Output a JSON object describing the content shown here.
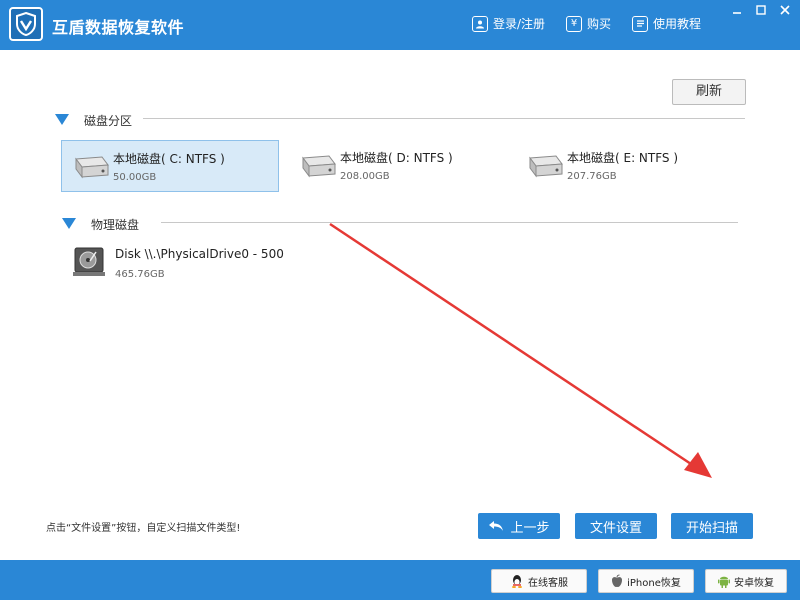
{
  "app": {
    "title": "互盾数据恢复软件"
  },
  "toolbar": {
    "login": "登录/注册",
    "buy": "购买",
    "tutorial": "使用教程",
    "buy_glyph": "¥"
  },
  "refresh_label": "刷新",
  "sections": {
    "partitions": "磁盘分区",
    "physical": "物理磁盘"
  },
  "partitions": [
    {
      "name": "本地磁盘( C: NTFS )",
      "size": "50.00GB",
      "selected": true
    },
    {
      "name": "本地磁盘( D: NTFS )",
      "size": "208.00GB",
      "selected": false
    },
    {
      "name": "本地磁盘( E: NTFS )",
      "size": "207.76GB",
      "selected": false
    }
  ],
  "physical_disks": [
    {
      "name": "Disk \\\\.\\PhysicalDrive0 - 500",
      "size": "465.76GB"
    }
  ],
  "hint": "点击“文件设置”按钮，自定义扫描文件类型!",
  "buttons": {
    "back": "上一步",
    "file_settings": "文件设置",
    "start_scan": "开始扫描"
  },
  "bottom": {
    "service": "在线客服",
    "iphone": "iPhone恢复",
    "android": "安卓恢复"
  },
  "colors": {
    "accent": "#2a87d6",
    "selected_bg": "#d8eaf8",
    "arrow": "#e53935"
  }
}
